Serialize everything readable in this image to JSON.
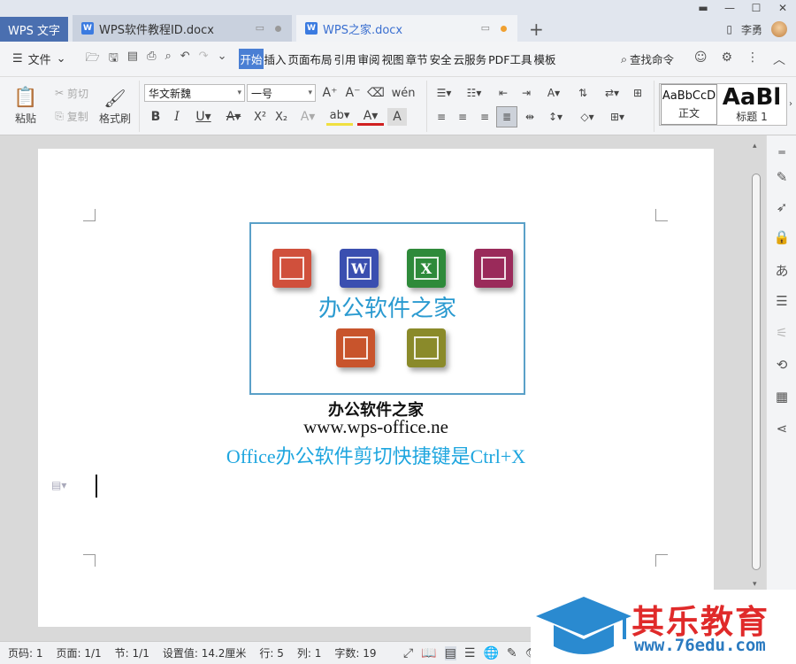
{
  "window": {
    "app_tab": "WPS 文字",
    "tabs": [
      {
        "label": "WPS软件教程ID.docx"
      },
      {
        "label": "WPS之家.docx"
      }
    ],
    "user_name": "李勇"
  },
  "menubar": {
    "file_label": "文件",
    "items": [
      "开始",
      "插入",
      "页面布局",
      "引用",
      "审阅",
      "视图",
      "章节",
      "安全",
      "云服务",
      "PDF工具",
      "模板"
    ],
    "active_item": "开始",
    "find_label": "查找命令"
  },
  "ribbon": {
    "paste": "粘贴",
    "cut": "剪切",
    "copy": "复制",
    "format_painter": "格式刷",
    "font_name": "华文新魏",
    "font_size": "一号",
    "styles": [
      {
        "preview": "AaBbCcD",
        "label": "正文"
      },
      {
        "preview": "AaBl",
        "label": "标题 1"
      }
    ]
  },
  "document": {
    "logo_text": "办公软件之家",
    "line1": "办公软件之家",
    "line2": "www.wps-office.ne",
    "line3": "Office办公软件剪切快捷键是Ctrl+X",
    "app_icons": [
      {
        "letter": "",
        "color": "#d0503c"
      },
      {
        "letter": "W",
        "color": "#3a4fb0"
      },
      {
        "letter": "X",
        "color": "#2e8a3a"
      },
      {
        "letter": "",
        "color": "#9a2a5a"
      },
      {
        "letter": "",
        "color": "#c8542c"
      },
      {
        "letter": "",
        "color": "#8a8a2a"
      }
    ]
  },
  "statusbar": {
    "page_num": "页码: 1",
    "pages": "页面: 1/1",
    "section": "节: 1/1",
    "setting": "设置值: 14.2厘米",
    "row": "行: 5",
    "col": "列: 1",
    "words": "字数: 19"
  },
  "watermark": {
    "brand": "其乐教育",
    "url": "www.76edu.com"
  }
}
